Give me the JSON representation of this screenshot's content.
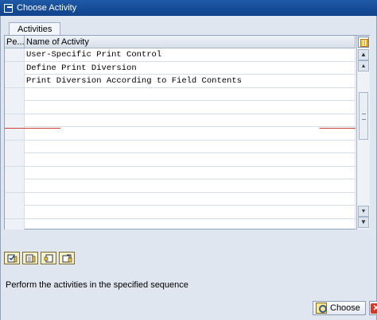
{
  "window": {
    "title": "Choose Activity"
  },
  "tabs": [
    {
      "label": "Activities"
    }
  ],
  "grid": {
    "columns": [
      {
        "label": "Pe..."
      },
      {
        "label": "Name of Activity"
      }
    ],
    "rows": [
      {
        "pe": "",
        "name": "User-Specific Print Control"
      },
      {
        "pe": "",
        "name": "Define Print Diversion"
      },
      {
        "pe": "",
        "name": "Print Diversion According to Field Contents"
      }
    ]
  },
  "toolbar": [
    {
      "icon": "select-all-icon"
    },
    {
      "icon": "deselect-all-icon"
    },
    {
      "icon": "select-block-icon"
    },
    {
      "icon": "details-icon"
    }
  ],
  "info": {
    "text": "Perform the activities in the specified sequence"
  },
  "footer": {
    "choose_label": "Choose"
  }
}
